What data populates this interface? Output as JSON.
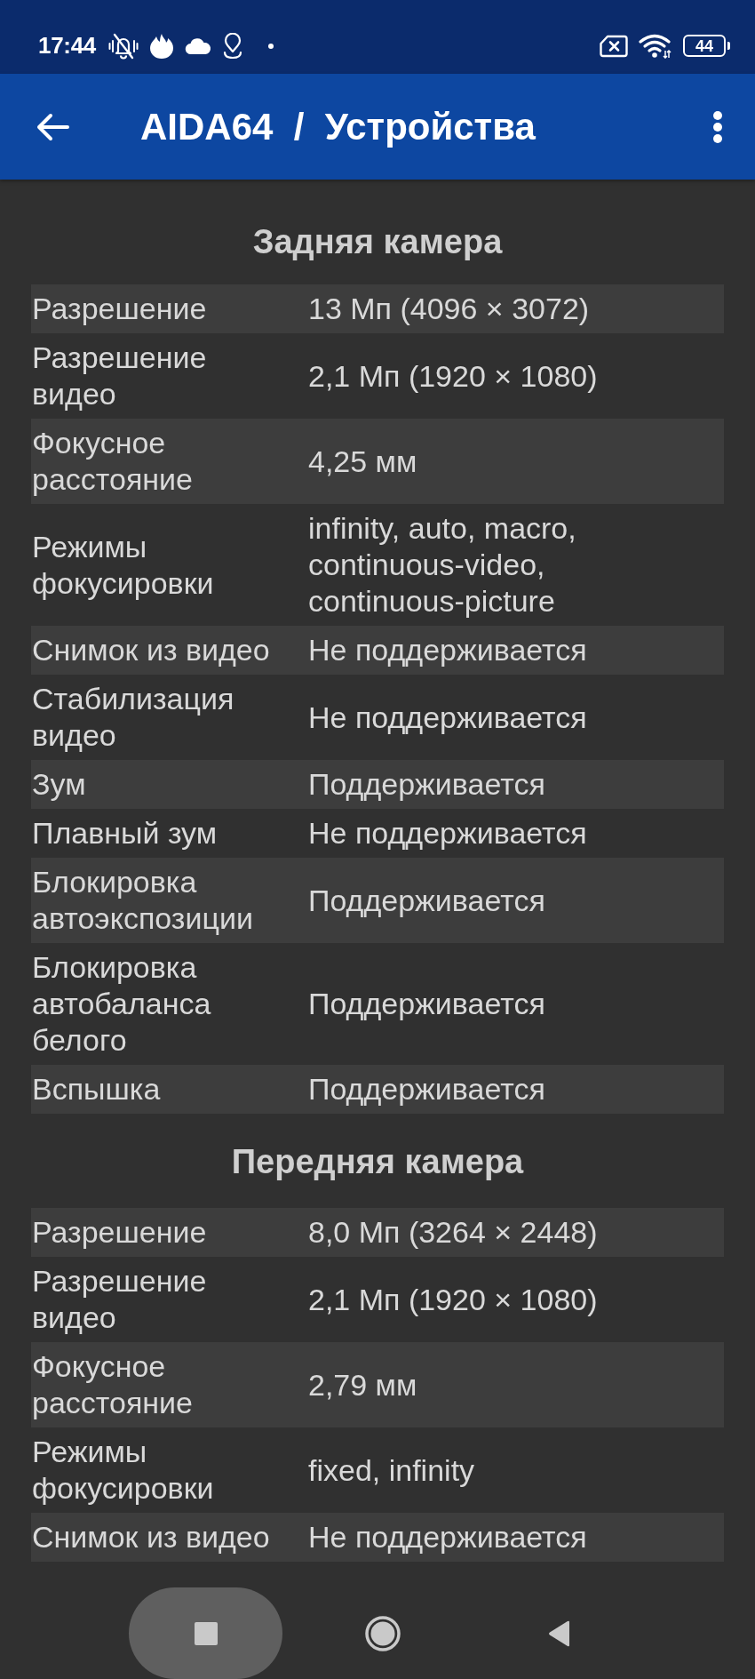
{
  "status_bar": {
    "time": "17:44",
    "battery": "44"
  },
  "app_bar": {
    "title": "AIDA64  /  Устройства"
  },
  "sections": [
    {
      "title": "Задняя камера",
      "rows": [
        {
          "label": "Разрешение",
          "value": "13 Мп (4096 × 3072)"
        },
        {
          "label": "Разрешение видео",
          "value": "2,1 Мп (1920 × 1080)"
        },
        {
          "label": "Фокусное расстояние",
          "value": "4,25 мм"
        },
        {
          "label": "Режимы фокусировки",
          "value": "infinity, auto, macro, continuous-video, continuous-picture"
        },
        {
          "label": "Снимок из видео",
          "value": "Не поддерживается"
        },
        {
          "label": "Стабилизация видео",
          "value": "Не поддерживается"
        },
        {
          "label": "Зум",
          "value": "Поддерживается"
        },
        {
          "label": "Плавный зум",
          "value": "Не поддерживается"
        },
        {
          "label": "Блокировка автоэкспозиции",
          "value": "Поддерживается"
        },
        {
          "label": "Блокировка автобаланса белого",
          "value": "Поддерживается"
        },
        {
          "label": "Вспышка",
          "value": "Поддерживается"
        }
      ]
    },
    {
      "title": "Передняя камера",
      "rows": [
        {
          "label": "Разрешение",
          "value": "8,0 Мп (3264 × 2448)"
        },
        {
          "label": "Разрешение видео",
          "value": "2,1 Мп (1920 × 1080)"
        },
        {
          "label": "Фокусное расстояние",
          "value": "2,79 мм"
        },
        {
          "label": "Режимы фокусировки",
          "value": "fixed, infinity"
        },
        {
          "label": "Снимок из видео",
          "value": "Не поддерживается"
        }
      ]
    }
  ],
  "nav_bar": {
    "buttons": [
      {
        "kind": "recents",
        "pressed": true
      },
      {
        "kind": "home",
        "pressed": false
      },
      {
        "kind": "back",
        "pressed": false
      }
    ]
  }
}
